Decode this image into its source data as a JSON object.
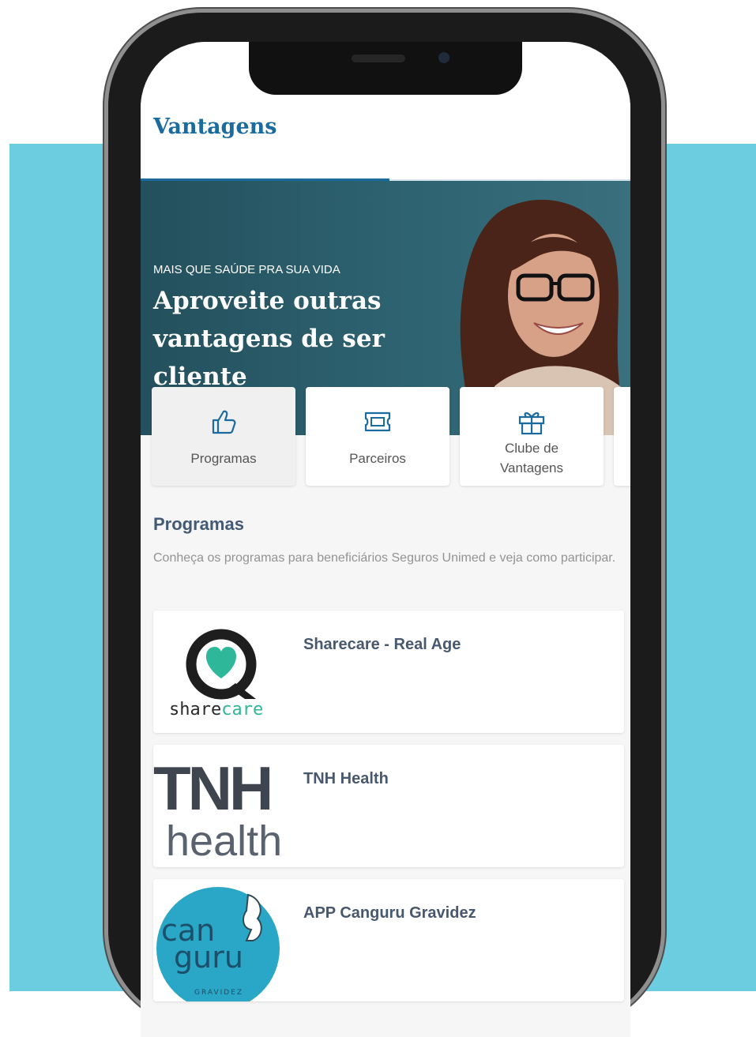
{
  "app": {
    "title": "Vantagens"
  },
  "hero": {
    "kicker": "MAIS QUE SAÚDE PRA SUA VIDA",
    "headline": "Aproveite outras vantagens de ser cliente"
  },
  "categories": [
    {
      "label": "Programas",
      "icon": "thumbs-up-icon",
      "active": true
    },
    {
      "label": "Parceiros",
      "icon": "ticket-icon",
      "active": false
    },
    {
      "label": "Clube de Vantagens",
      "label_line1": "Clube de",
      "label_line2": "Vantagens",
      "icon": "gift-icon",
      "active": false
    }
  ],
  "section": {
    "title": "Programas",
    "description": "Conheça os programas para beneficiários Seguros Unimed e veja como participar."
  },
  "programs": [
    {
      "name": "Sharecare - Real Age",
      "logo": {
        "text_dark": "share",
        "text_accent": "care"
      }
    },
    {
      "name": "TNH Health",
      "logo": {
        "line1": "TNH",
        "line2": "health"
      }
    },
    {
      "name": "APP Canguru Gravidez",
      "logo": {
        "line1": "can",
        "line2": "guru",
        "sub": "GRAVIDEZ"
      }
    }
  ],
  "colors": {
    "brand_blue": "#1b6b9e",
    "background_band": "#6ccde0",
    "hero_teal": "#2f6573",
    "sharecare_green": "#2fb79a",
    "canguru_blue": "#2aa6c6"
  }
}
